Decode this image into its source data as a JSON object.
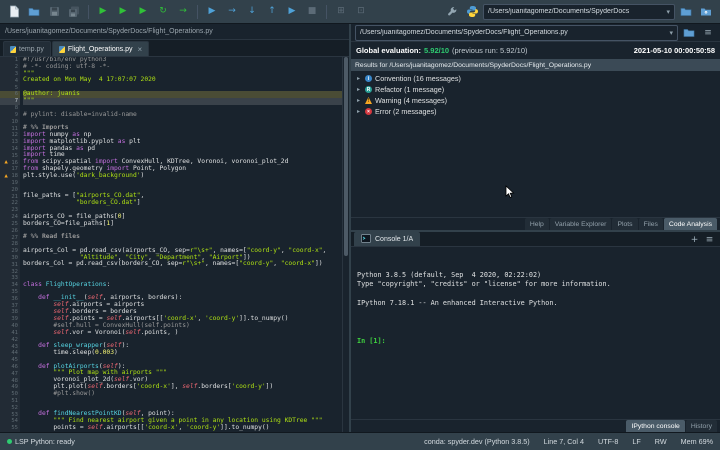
{
  "colors": {
    "background": "#19232D",
    "toolbar": "#32414B",
    "accent_blue": "#346792",
    "score_green": "#2ecc71",
    "warning_orange": "#f5a623",
    "error_red": "#d4373f",
    "keyword": "#c670e0",
    "string": "#b0e313",
    "definition": "#57d6e4",
    "number": "#faf976",
    "instance": "#ee6772",
    "comment": "#999999"
  },
  "icons": {
    "run": "▶",
    "run_cell": "▶",
    "run_cell_advance": "▶",
    "rerun_cell": "↻",
    "run_selection": "→",
    "debug": "▶",
    "step_over": "→",
    "step_into": "↓",
    "step_out": "↑",
    "continue_run": "▶",
    "stop": "■",
    "maximize": "⊞",
    "fullscreen": "⊡",
    "dropdown": "▾",
    "chevron": "▸",
    "warning": "▲",
    "hamburger": "≡",
    "plus": "+",
    "close": "×"
  },
  "main_toolbar": {
    "working_dir": "/Users/juanitagomez/Documents/SpyderDocs"
  },
  "editor": {
    "breadcrumb": "/Users/juanitagomez/Documents/SpyderDocs/Flight_Operations.py",
    "tabs": [
      {
        "label": "temp.py",
        "active": false,
        "closable": false
      },
      {
        "label": "Flight_Operations.py",
        "active": true,
        "closable": true
      }
    ],
    "current_line": 7,
    "highlight_line": 6,
    "warning_lines": [
      16,
      18
    ],
    "lines": [
      [
        [
          "c",
          "#!/usr/bin/env python3"
        ]
      ],
      [
        [
          "c",
          "# -*- coding: utf-8 -*-"
        ]
      ],
      [
        [
          "s",
          "\"\"\""
        ]
      ],
      [
        [
          "s",
          "Created on Mon May  4 17:07:07 2020"
        ]
      ],
      [],
      [
        [
          "s",
          "@author: juanis"
        ]
      ],
      [
        [
          "s",
          "\"\"\""
        ]
      ],
      [],
      [
        [
          "c",
          "# pylint: disable=invalid-name"
        ]
      ],
      [],
      [
        [
          "cb",
          "# %% Imports"
        ]
      ],
      [
        [
          "k",
          "import"
        ],
        [
          "t",
          " numpy "
        ],
        [
          "k",
          "as"
        ],
        [
          "t",
          " np"
        ]
      ],
      [
        [
          "k",
          "import"
        ],
        [
          "t",
          " matplotlib.pyplot "
        ],
        [
          "k",
          "as"
        ],
        [
          "t",
          " plt"
        ]
      ],
      [
        [
          "k",
          "import"
        ],
        [
          "t",
          " pandas "
        ],
        [
          "k",
          "as"
        ],
        [
          "t",
          " pd"
        ]
      ],
      [
        [
          "k",
          "import"
        ],
        [
          "t",
          " time"
        ]
      ],
      [
        [
          "k",
          "from"
        ],
        [
          "t",
          " scipy.spatial "
        ],
        [
          "k",
          "import"
        ],
        [
          "t",
          " ConvexHull, KDTree, Voronoi, voronoi_plot_2d"
        ]
      ],
      [
        [
          "k",
          "from"
        ],
        [
          "t",
          " shapely.geometry "
        ],
        [
          "k",
          "import"
        ],
        [
          "t",
          " Point, Polygon"
        ]
      ],
      [
        [
          "t",
          "plt.style.use("
        ],
        [
          "s",
          "'dark_background'"
        ],
        [
          "t",
          ")"
        ]
      ],
      [],
      [],
      [
        [
          "t",
          "file_paths = ["
        ],
        [
          "s",
          "\"airports_CO.dat\""
        ],
        [
          "t",
          ","
        ]
      ],
      [
        [
          "t",
          "              "
        ],
        [
          "s",
          "\"borders_CO.dat\""
        ],
        [
          "t",
          "]"
        ]
      ],
      [],
      [
        [
          "t",
          "airports_CO = file_paths["
        ],
        [
          "n",
          "0"
        ],
        [
          "t",
          "]"
        ]
      ],
      [
        [
          "t",
          "borders_CO=file_paths["
        ],
        [
          "n",
          "1"
        ],
        [
          "t",
          "]"
        ]
      ],
      [],
      [
        [
          "cb",
          "# %% Read files"
        ]
      ],
      [],
      [
        [
          "t",
          "airports_Col = pd.read_csv(airports_CO, sep="
        ],
        [
          "s",
          "r\"\\s+\""
        ],
        [
          "t",
          ", names=["
        ],
        [
          "s",
          "\"coord-y\""
        ],
        [
          "t",
          ", "
        ],
        [
          "s",
          "\"coord-x\""
        ],
        [
          "t",
          ","
        ]
      ],
      [
        [
          "t",
          "               "
        ],
        [
          "s",
          "\"Altitude\""
        ],
        [
          "t",
          ", "
        ],
        [
          "s",
          "\"City\""
        ],
        [
          "t",
          ", "
        ],
        [
          "s",
          "\"Department\""
        ],
        [
          "t",
          ", "
        ],
        [
          "s",
          "\"Airport\""
        ],
        [
          "t",
          "])"
        ]
      ],
      [
        [
          "t",
          "borders_Col = pd.read_csv(borders_CO, sep="
        ],
        [
          "s",
          "r\"\\s+\""
        ],
        [
          "t",
          ", names=["
        ],
        [
          "s",
          "\"coord-y\""
        ],
        [
          "t",
          ", "
        ],
        [
          "s",
          "\"coord-x\""
        ],
        [
          "t",
          "])"
        ]
      ],
      [],
      [],
      [
        [
          "k",
          "class"
        ],
        [
          "t",
          " "
        ],
        [
          "d",
          "FlightOperations"
        ],
        [
          "t",
          ":"
        ]
      ],
      [],
      [
        [
          "t",
          "    "
        ],
        [
          "k",
          "def"
        ],
        [
          "t",
          " "
        ],
        [
          "d",
          "__init__"
        ],
        [
          "t",
          "("
        ],
        [
          "i",
          "self"
        ],
        [
          "t",
          ", airports, borders):"
        ]
      ],
      [
        [
          "t",
          "        "
        ],
        [
          "i",
          "self"
        ],
        [
          "t",
          ".airports = airports"
        ]
      ],
      [
        [
          "t",
          "        "
        ],
        [
          "i",
          "self"
        ],
        [
          "t",
          ".borders = borders"
        ]
      ],
      [
        [
          "t",
          "        "
        ],
        [
          "i",
          "self"
        ],
        [
          "t",
          ".points = "
        ],
        [
          "i",
          "self"
        ],
        [
          "t",
          ".airports[["
        ],
        [
          "s",
          "'coord-x'"
        ],
        [
          "t",
          ", "
        ],
        [
          "s",
          "'coord-y'"
        ],
        [
          "t",
          "]].to_numpy()"
        ]
      ],
      [
        [
          "c",
          "        #self.hull = ConvexHull(self.points)"
        ]
      ],
      [
        [
          "t",
          "        "
        ],
        [
          "i",
          "self"
        ],
        [
          "t",
          ".vor = Voronoi("
        ],
        [
          "i",
          "self"
        ],
        [
          "t",
          ".points, )"
        ]
      ],
      [],
      [
        [
          "t",
          "    "
        ],
        [
          "k",
          "def"
        ],
        [
          "t",
          " "
        ],
        [
          "d",
          "sleep_wrapper"
        ],
        [
          "t",
          "("
        ],
        [
          "i",
          "self"
        ],
        [
          "t",
          "):"
        ]
      ],
      [
        [
          "t",
          "        time.sleep("
        ],
        [
          "n",
          "0.003"
        ],
        [
          "t",
          ")"
        ]
      ],
      [],
      [
        [
          "t",
          "    "
        ],
        [
          "k",
          "def"
        ],
        [
          "t",
          " "
        ],
        [
          "d",
          "plotAirports"
        ],
        [
          "t",
          "("
        ],
        [
          "i",
          "self"
        ],
        [
          "t",
          "):"
        ]
      ],
      [
        [
          "t",
          "        "
        ],
        [
          "s",
          "\"\"\" Plot map with airports \"\"\""
        ]
      ],
      [
        [
          "t",
          "        voronoi_plot_2d("
        ],
        [
          "i",
          "self"
        ],
        [
          "t",
          ".vor)"
        ]
      ],
      [
        [
          "t",
          "        plt.plot("
        ],
        [
          "i",
          "self"
        ],
        [
          "t",
          ".borders["
        ],
        [
          "s",
          "'coord-x'"
        ],
        [
          "t",
          "], "
        ],
        [
          "i",
          "self"
        ],
        [
          "t",
          ".borders["
        ],
        [
          "s",
          "'coord-y'"
        ],
        [
          "t",
          "])"
        ]
      ],
      [
        [
          "c",
          "        #plt.show()"
        ]
      ],
      [],
      [],
      [
        [
          "t",
          "    "
        ],
        [
          "k",
          "def"
        ],
        [
          "t",
          " "
        ],
        [
          "d",
          "findNearestPointKD"
        ],
        [
          "t",
          "("
        ],
        [
          "i",
          "self"
        ],
        [
          "t",
          ", point):"
        ]
      ],
      [
        [
          "t",
          "        "
        ],
        [
          "s",
          "\"\"\" Find nearest airport given a point in any location using KDTree \"\"\""
        ]
      ],
      [
        [
          "t",
          "        points = "
        ],
        [
          "i",
          "self"
        ],
        [
          "t",
          ".airports[["
        ],
        [
          "s",
          "'coord-x'"
        ],
        [
          "t",
          ", "
        ],
        [
          "s",
          "'coord-y'"
        ],
        [
          "t",
          "]].to_numpy()"
        ]
      ]
    ]
  },
  "analysis": {
    "path": "/Users/juanitagomez/Documents/SpyderDocs/Flight_Operations.py",
    "eval_label": "Global evaluation:",
    "score": "5.92/10",
    "previous": "(previous run: 5.92/10)",
    "date": "2021-05-10 00:00:50:58",
    "results_header": "Results for /Users/juanitagomez/Documents/SpyderDocs/Flight_Operations.py",
    "items": [
      {
        "type": "convention",
        "glyph": "i",
        "label": "Convention (16 messages)"
      },
      {
        "type": "refactor",
        "glyph": "R",
        "label": "Refactor (1 message)"
      },
      {
        "type": "warning",
        "glyph": "!",
        "label": "Warning (4 messages)"
      },
      {
        "type": "error",
        "glyph": "×",
        "label": "Error (2 messages)"
      }
    ],
    "tabs": [
      "Help",
      "Variable Explorer",
      "Plots",
      "Files",
      "Code Analysis"
    ],
    "active_tab": "Code Analysis"
  },
  "console": {
    "tab_label": "Console 1/A",
    "lines": [
      "Python 3.8.5 (default, Sep  4 2020, 02:22:02)",
      "Type \"copyright\", \"credits\" or \"license\" for more information.",
      "",
      "IPython 7.18.1 -- An enhanced Interactive Python.",
      ""
    ],
    "prompt": "In [1]:",
    "tabs": [
      "IPython console",
      "History"
    ],
    "active_tab": "IPython console"
  },
  "statusbar": {
    "lsp": "LSP Python: ready",
    "env": "conda: spyder.dev (Python 3.8.5)",
    "cursor": "Line 7, Col 4",
    "encoding": "UTF-8",
    "eol": "LF",
    "permissions": "RW",
    "memory": "Mem 69%"
  }
}
